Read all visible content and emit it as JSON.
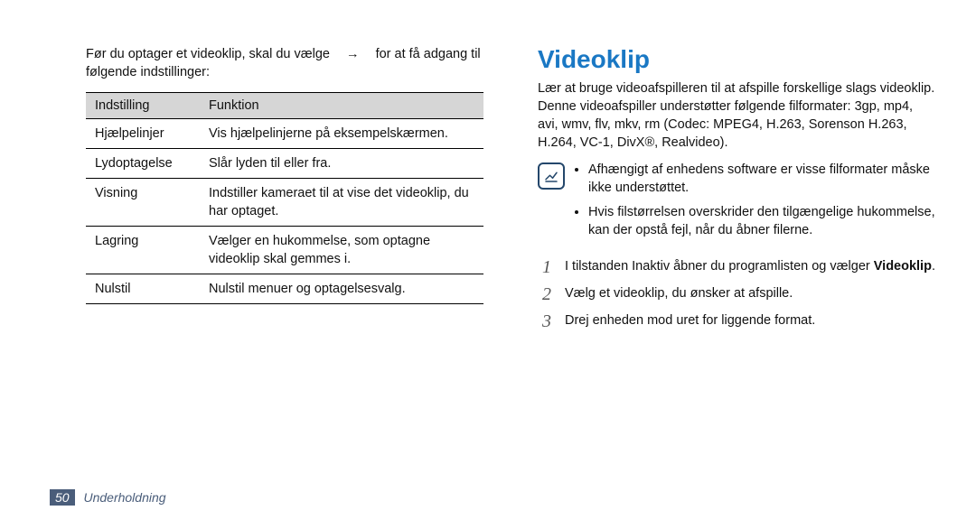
{
  "left": {
    "intro_pre": "Før du optager et videoklip, skal du vælge",
    "intro_arrow": "→",
    "intro_post": "for at få adgang til følgende indstillinger:",
    "th1": "Indstilling",
    "th2": "Funktion",
    "rows": [
      {
        "k": "Hjælpelinjer",
        "v": "Vis hjælpelinjerne på eksempelskærmen."
      },
      {
        "k": "Lydoptagelse",
        "v": "Slår lyden til eller fra."
      },
      {
        "k": "Visning",
        "v": "Indstiller kameraet til at vise det videoklip, du har optaget."
      },
      {
        "k": "Lagring",
        "v": "Vælger en hukommelse, som optagne videoklip skal gemmes i."
      },
      {
        "k": "Nulstil",
        "v": "Nulstil menuer og optagelsesvalg."
      }
    ]
  },
  "right": {
    "title": "Videoklip",
    "body": "Lær at bruge videoafspilleren til at afspille forskellige slags videoklip. Denne videoafspiller understøtter følgende filformater: 3gp, mp4, avi, wmv, flv, mkv, rm (Codec: MPEG4, H.263, Sorenson H.263, H.264, VC-1, DivX®, Realvideo).",
    "notes": [
      "Afhængigt af enhedens software er visse filformater måske ikke understøttet.",
      "Hvis filstørrelsen overskrider den tilgængelige hukommelse, kan der opstå fejl, når du åbner filerne."
    ],
    "steps": [
      {
        "n": "1",
        "t_pre": "I tilstanden Inaktiv åbner du programlisten og vælger ",
        "bold": "Videoklip",
        "t_post": "."
      },
      {
        "n": "2",
        "t_pre": "Vælg et videoklip, du ønsker at afspille.",
        "bold": "",
        "t_post": ""
      },
      {
        "n": "3",
        "t_pre": "Drej enheden mod uret for liggende format.",
        "bold": "",
        "t_post": ""
      }
    ]
  },
  "footer": {
    "page": "50",
    "section": "Underholdning"
  }
}
